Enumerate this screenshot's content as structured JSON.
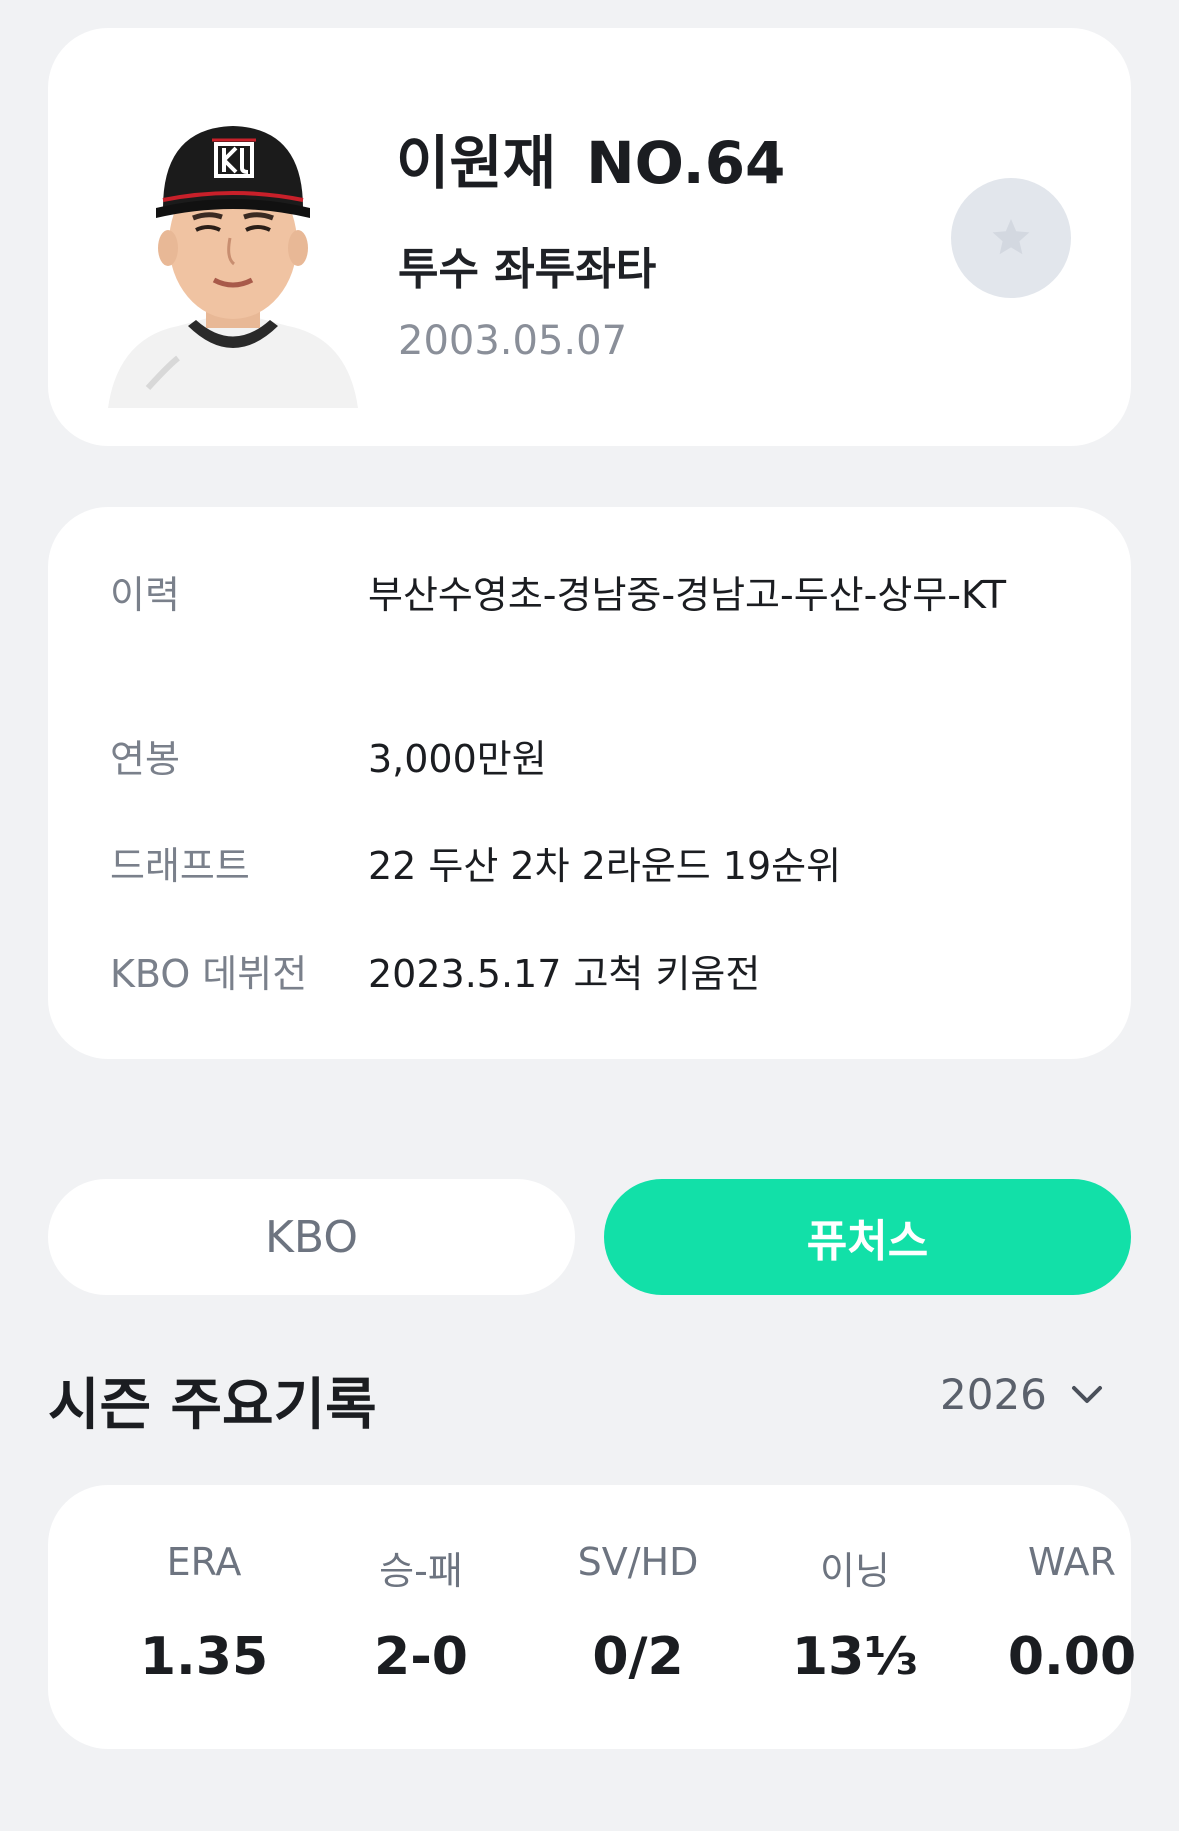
{
  "profile": {
    "name": "이원재",
    "number": "NO.64",
    "position": "투수 좌투좌타",
    "birthdate": "2003.05.07",
    "favorite_icon": "star-icon"
  },
  "info": [
    {
      "label": "이력",
      "value": "부산수영초-경남중-경남고-두산-상무-KT"
    },
    {
      "label": "연봉",
      "value": "3,000만원"
    },
    {
      "label": "드래프트",
      "value": "22 두산 2차 2라운드 19순위"
    },
    {
      "label": "KBO 데뷔전",
      "value": "2023.5.17 고척 키움전"
    }
  ],
  "tabs": [
    {
      "label": "KBO",
      "selected": false
    },
    {
      "label": "퓨처스",
      "selected": true
    }
  ],
  "season": {
    "title": "시즌 주요기록",
    "year": "2026",
    "dropdown_icon": "chevron-down-icon"
  },
  "stats": [
    {
      "label": "ERA",
      "value": "1.35"
    },
    {
      "label": "승-패",
      "value": "2-0"
    },
    {
      "label": "SV/HD",
      "value": "0/2"
    },
    {
      "label": "이닝",
      "value": "13⅓"
    },
    {
      "label": "WAR",
      "value": "0.00"
    }
  ],
  "colors": {
    "background": "#f1f2f4",
    "card": "#ffffff",
    "accent": "#12e0a8",
    "muted_text": "#7a808b",
    "favorite_button": "#e2e6ec"
  }
}
